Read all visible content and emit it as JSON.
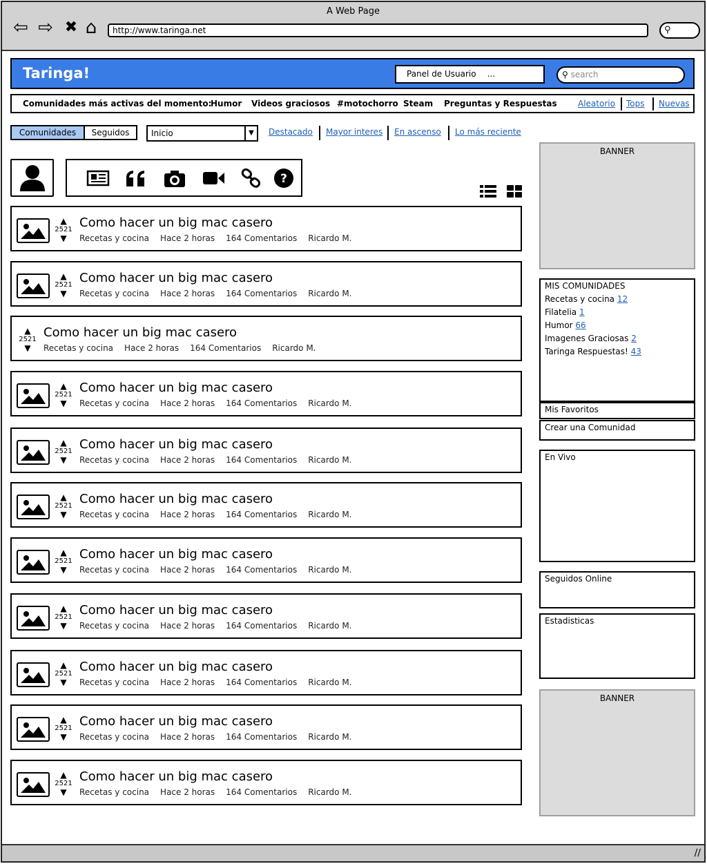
{
  "browser": {
    "window_title": "A Web Page",
    "url": "http://www.taringa.net",
    "nav": {
      "back": "⇦",
      "forward": "⇨",
      "close": "✖",
      "home": "⌂"
    }
  },
  "header": {
    "logo": "Taringa!",
    "user_panel_label": "Panel de Usuario",
    "user_panel_ellipsis": "...",
    "search_placeholder": "search",
    "brand_color": "#3a7ce6"
  },
  "communities_bar": {
    "lead": "Comunidades más activas del momento:",
    "items": [
      "Humor",
      "Videos graciosos",
      "#motochorro",
      "Steam",
      "Preguntas y Respuestas"
    ],
    "links": [
      "Aleatorio",
      "Tops",
      "Nuevas"
    ]
  },
  "toolbar": {
    "tabs": [
      "Comunidades",
      "Seguidos"
    ],
    "active_tab": "Comunidades",
    "select_value": "Inicio",
    "filters": [
      "Destacado",
      "Mayor interes",
      "En ascenso",
      "Lo más reciente"
    ]
  },
  "post_types": [
    "news-icon",
    "quote-icon",
    "camera-icon",
    "video-icon",
    "link-icon",
    "question-icon"
  ],
  "posts": [
    {
      "title": "Como hacer un big mac casero",
      "votes": "2521",
      "category": "Recetas y cocina",
      "time": "Hace 2 horas",
      "comments": "164 Comentarios",
      "author": "Ricardo M.",
      "has_thumb": true
    },
    {
      "title": "Como hacer un big mac casero",
      "votes": "2521",
      "category": "Recetas y cocina",
      "time": "Hace 2 horas",
      "comments": "164 Comentarios",
      "author": "Ricardo M.",
      "has_thumb": true
    },
    {
      "title": "Como hacer un big mac casero",
      "votes": "2521",
      "category": "Recetas y cocina",
      "time": "Hace 2 horas",
      "comments": "164 Comentarios",
      "author": "Ricardo M.",
      "has_thumb": false
    },
    {
      "title": "Como hacer un big mac casero",
      "votes": "2521",
      "category": "Recetas y cocina",
      "time": "Hace 2 horas",
      "comments": "164 Comentarios",
      "author": "Ricardo M.",
      "has_thumb": true
    },
    {
      "title": "Como hacer un big mac casero",
      "votes": "2521",
      "category": "Recetas y cocina",
      "time": "Hace 2 horas",
      "comments": "164 Comentarios",
      "author": "Ricardo M.",
      "has_thumb": true
    },
    {
      "title": "Como hacer un big mac casero",
      "votes": "2521",
      "category": "Recetas y cocina",
      "time": "Hace 2 horas",
      "comments": "164 Comentarios",
      "author": "Ricardo M.",
      "has_thumb": true
    },
    {
      "title": "Como hacer un big mac casero",
      "votes": "2521",
      "category": "Recetas y cocina",
      "time": "Hace 2 horas",
      "comments": "164 Comentarios",
      "author": "Ricardo M.",
      "has_thumb": true
    },
    {
      "title": "Como hacer un big mac casero",
      "votes": "2521",
      "category": "Recetas y cocina",
      "time": "Hace 2 horas",
      "comments": "164 Comentarios",
      "author": "Ricardo M.",
      "has_thumb": true
    },
    {
      "title": "Como hacer un big mac casero",
      "votes": "2521",
      "category": "Recetas y cocina",
      "time": "Hace 2 horas",
      "comments": "164 Comentarios",
      "author": "Ricardo M.",
      "has_thumb": true
    },
    {
      "title": "Como hacer un big mac casero",
      "votes": "2521",
      "category": "Recetas y cocina",
      "time": "Hace 2 horas",
      "comments": "164 Comentarios",
      "author": "Ricardo M.",
      "has_thumb": true
    },
    {
      "title": "Como hacer un big mac casero",
      "votes": "2521",
      "category": "Recetas y cocina",
      "time": "Hace 2 horas",
      "comments": "164 Comentarios",
      "author": "Ricardo M.",
      "has_thumb": true
    }
  ],
  "sidebar": {
    "banner_top": "BANNER",
    "my_communities_title": "MIS COMUNIDADES",
    "my_communities": [
      {
        "name": "Recetas y cocina",
        "count": "12"
      },
      {
        "name": "Filatelia",
        "count": "1"
      },
      {
        "name": "Humor",
        "count": "66"
      },
      {
        "name": "Imagenes Graciosas",
        "count": "2"
      },
      {
        "name": "Taringa Respuestas!",
        "count": "43"
      }
    ],
    "favorites": "Mis Favoritos",
    "create_community": "Crear una Comunidad",
    "live": "En Vivo",
    "followed_online": "Seguidos Online",
    "stats": "Estadisticas",
    "banner_bottom": "BANNER"
  }
}
